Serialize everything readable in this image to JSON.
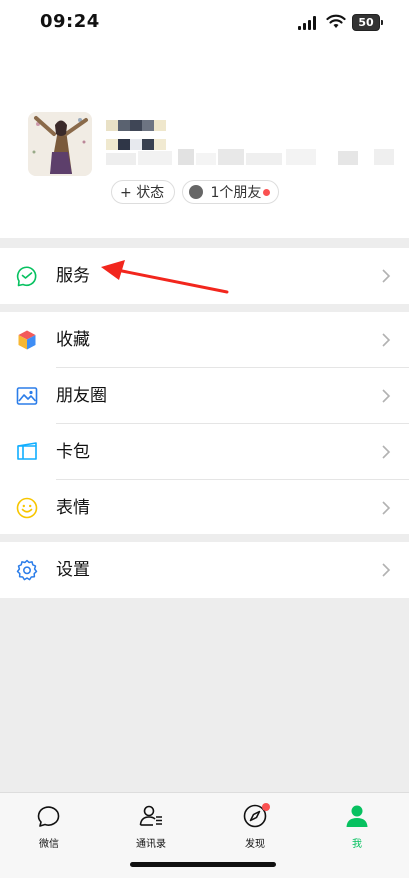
{
  "status_bar": {
    "time": "09:24",
    "battery": "50"
  },
  "profile": {
    "add_status_label": "状态",
    "friends_label": "1个朋友"
  },
  "menu": {
    "service": "服务",
    "favorites": "收藏",
    "moments": "朋友圈",
    "cards": "卡包",
    "stickers": "表情",
    "settings": "设置"
  },
  "tabs": {
    "chats": "微信",
    "contacts": "通讯录",
    "discover": "发现",
    "me": "我"
  },
  "colors": {
    "accent": "#07c160",
    "badge": "#fa5151",
    "arrow": "#f2261d"
  }
}
